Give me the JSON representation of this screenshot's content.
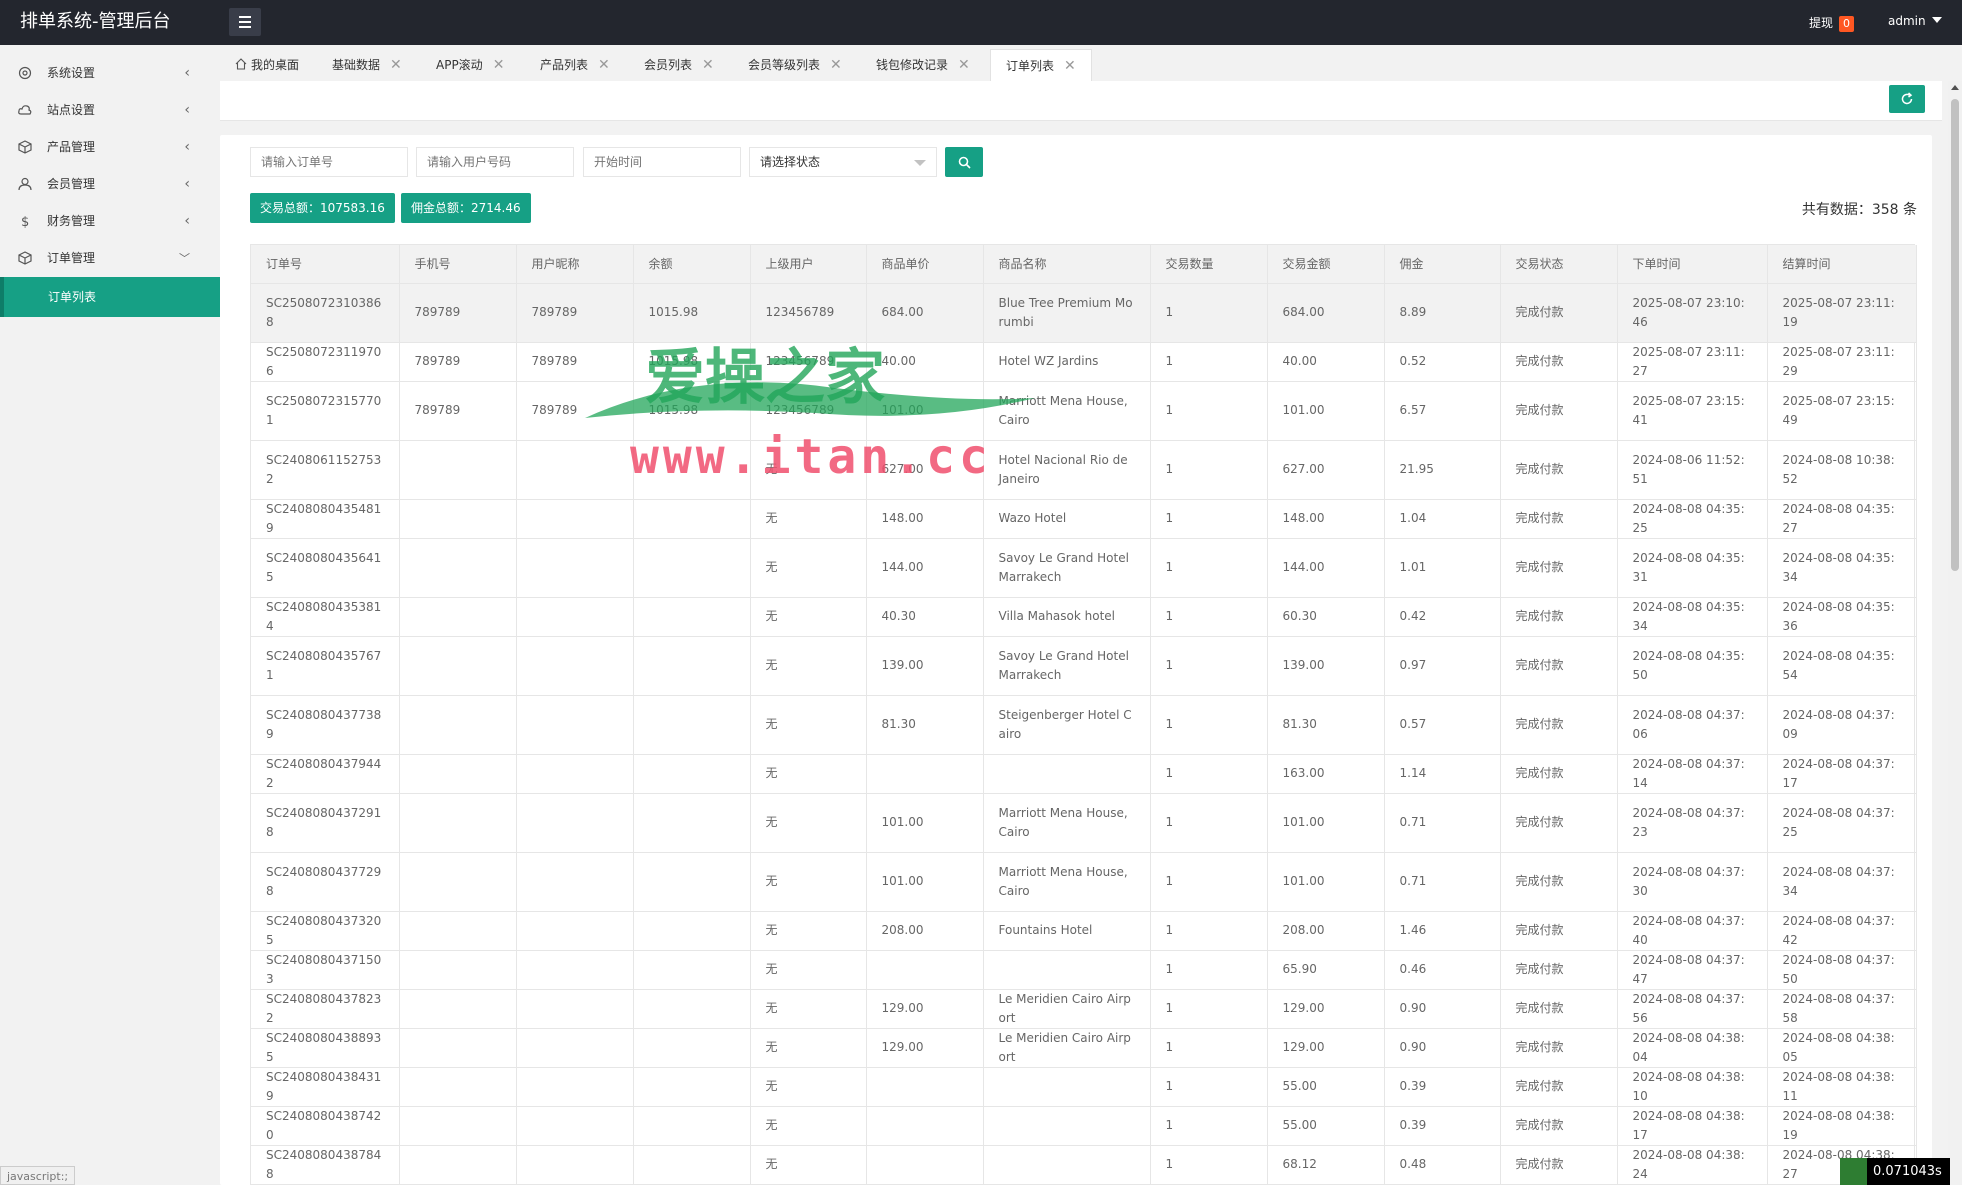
{
  "header": {
    "title": "排单系统-管理后台",
    "withdraw_label": "提现",
    "withdraw_count": "0",
    "user": "admin"
  },
  "sidebar": {
    "items": [
      {
        "label": "系统设置",
        "icon": "gear-icon"
      },
      {
        "label": "站点设置",
        "icon": "cloud-icon"
      },
      {
        "label": "产品管理",
        "icon": "box-icon"
      },
      {
        "label": "会员管理",
        "icon": "user-icon"
      },
      {
        "label": "财务管理",
        "icon": "dollar-icon"
      },
      {
        "label": "订单管理",
        "icon": "box-icon"
      }
    ],
    "active_sub": "订单列表"
  },
  "tabs": [
    {
      "label": "我的桌面"
    },
    {
      "label": "基础数据"
    },
    {
      "label": "APP滚动"
    },
    {
      "label": "产品列表"
    },
    {
      "label": "会员列表"
    },
    {
      "label": "会员等级列表"
    },
    {
      "label": "钱包修改记录"
    },
    {
      "label": "订单列表"
    }
  ],
  "search": {
    "order_placeholder": "请输入订单号",
    "user_placeholder": "请输入用户号码",
    "time_placeholder": "开始时间",
    "status_select": "请选择状态"
  },
  "stats": {
    "trade_total": "交易总额：107583.16",
    "commission_total": "佣金总额：2714.46",
    "record_count": "共有数据：358 条"
  },
  "table": {
    "headers": [
      "订单号",
      "手机号",
      "用户昵称",
      "余额",
      "上级用户",
      "商品单价",
      "商品名称",
      "交易数量",
      "交易金额",
      "佣金",
      "交易状态",
      "下单时间",
      "结算时间"
    ],
    "rows": [
      [
        "SC25080723103868",
        "789789",
        "789789",
        "1015.98",
        "123456789",
        "684.00",
        "Blue Tree Premium Morumbi",
        "1",
        "684.00",
        "8.89",
        "完成付款",
        "2025-08-07 23:10:46",
        "2025-08-07 23:11:19"
      ],
      [
        "SC25080723119706",
        "789789",
        "789789",
        "1015.98",
        "123456789",
        "40.00",
        "Hotel WZ Jardins",
        "1",
        "40.00",
        "0.52",
        "完成付款",
        "2025-08-07 23:11:27",
        "2025-08-07 23:11:29"
      ],
      [
        "SC25080723157701",
        "789789",
        "789789",
        "1015.98",
        "123456789",
        "101.00",
        "Marriott Mena House, Cairo",
        "1",
        "101.00",
        "6.57",
        "完成付款",
        "2025-08-07 23:15:41",
        "2025-08-07 23:15:49"
      ],
      [
        "SC24080611527532",
        "",
        "",
        "",
        "无",
        "627.00",
        "Hotel Nacional Rio de Janeiro",
        "1",
        "627.00",
        "21.95",
        "完成付款",
        "2024-08-06 11:52:51",
        "2024-08-08 10:38:52"
      ],
      [
        "SC24080804354819",
        "",
        "",
        "",
        "无",
        "148.00",
        "Wazo Hotel",
        "1",
        "148.00",
        "1.04",
        "完成付款",
        "2024-08-08 04:35:25",
        "2024-08-08 04:35:27"
      ],
      [
        "SC24080804356415",
        "",
        "",
        "",
        "无",
        "144.00",
        "Savoy Le Grand Hotel Marrakech",
        "1",
        "144.00",
        "1.01",
        "完成付款",
        "2024-08-08 04:35:31",
        "2024-08-08 04:35:34"
      ],
      [
        "SC24080804353814",
        "",
        "",
        "",
        "无",
        "40.30",
        "Villa Mahasok hotel",
        "1",
        "60.30",
        "0.42",
        "完成付款",
        "2024-08-08 04:35:34",
        "2024-08-08 04:35:36"
      ],
      [
        "SC24080804357671",
        "",
        "",
        "",
        "无",
        "139.00",
        "Savoy Le Grand Hotel Marrakech",
        "1",
        "139.00",
        "0.97",
        "完成付款",
        "2024-08-08 04:35:50",
        "2024-08-08 04:35:54"
      ],
      [
        "SC24080804377389",
        "",
        "",
        "",
        "无",
        "81.30",
        "Steigenberger Hotel Cairo",
        "1",
        "81.30",
        "0.57",
        "完成付款",
        "2024-08-08 04:37:06",
        "2024-08-08 04:37:09"
      ],
      [
        "SC24080804379442",
        "",
        "",
        "",
        "无",
        "",
        "",
        "1",
        "163.00",
        "1.14",
        "完成付款",
        "2024-08-08 04:37:14",
        "2024-08-08 04:37:17"
      ],
      [
        "SC24080804372918",
        "",
        "",
        "",
        "无",
        "101.00",
        "Marriott Mena House, Cairo",
        "1",
        "101.00",
        "0.71",
        "完成付款",
        "2024-08-08 04:37:23",
        "2024-08-08 04:37:25"
      ],
      [
        "SC24080804377298",
        "",
        "",
        "",
        "无",
        "101.00",
        "Marriott Mena House, Cairo",
        "1",
        "101.00",
        "0.71",
        "完成付款",
        "2024-08-08 04:37:30",
        "2024-08-08 04:37:34"
      ],
      [
        "SC24080804373205",
        "",
        "",
        "",
        "无",
        "208.00",
        "Fountains Hotel",
        "1",
        "208.00",
        "1.46",
        "完成付款",
        "2024-08-08 04:37:40",
        "2024-08-08 04:37:42"
      ],
      [
        "SC24080804371503",
        "",
        "",
        "",
        "无",
        "",
        "",
        "1",
        "65.90",
        "0.46",
        "完成付款",
        "2024-08-08 04:37:47",
        "2024-08-08 04:37:50"
      ],
      [
        "SC24080804378232",
        "",
        "",
        "",
        "无",
        "129.00",
        "Le Meridien Cairo Airport",
        "1",
        "129.00",
        "0.90",
        "完成付款",
        "2024-08-08 04:37:56",
        "2024-08-08 04:37:58"
      ],
      [
        "SC24080804388935",
        "",
        "",
        "",
        "无",
        "129.00",
        "Le Meridien Cairo Airport",
        "1",
        "129.00",
        "0.90",
        "完成付款",
        "2024-08-08 04:38:04",
        "2024-08-08 04:38:05"
      ],
      [
        "SC24080804384319",
        "",
        "",
        "",
        "无",
        "",
        "",
        "1",
        "55.00",
        "0.39",
        "完成付款",
        "2024-08-08 04:38:10",
        "2024-08-08 04:38:11"
      ],
      [
        "SC24080804387420",
        "",
        "",
        "",
        "无",
        "",
        "",
        "1",
        "55.00",
        "0.39",
        "完成付款",
        "2024-08-08 04:38:17",
        "2024-08-08 04:38:19"
      ],
      [
        "SC24080804387848",
        "",
        "",
        "",
        "无",
        "",
        "",
        "1",
        "68.12",
        "0.48",
        "完成付款",
        "2024-08-08 04:38:24",
        "2024-08-08 04:38:27"
      ]
    ]
  },
  "watermark": {
    "title": "爱操之家",
    "url": "www.itan.cc"
  },
  "browser": {
    "status_text": "javascript:;",
    "timer": "0.071043s"
  },
  "colors": {
    "accent": "#16a085",
    "header_bg": "#23262e",
    "badge": "#ff5722"
  }
}
